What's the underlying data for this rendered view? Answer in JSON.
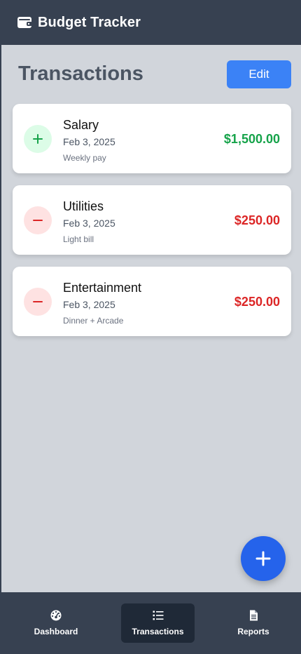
{
  "app": {
    "title": "Budget Tracker"
  },
  "page": {
    "title": "Transactions",
    "edit_label": "Edit"
  },
  "transactions": [
    {
      "name": "Salary",
      "date": "Feb 3, 2025",
      "note": "Weekly pay",
      "amount": "$1,500.00",
      "type": "income"
    },
    {
      "name": "Utilities",
      "date": "Feb 3, 2025",
      "note": "Light bill",
      "amount": "$250.00",
      "type": "expense"
    },
    {
      "name": "Entertainment",
      "date": "Feb 3, 2025",
      "note": "Dinner + Arcade",
      "amount": "$250.00",
      "type": "expense"
    }
  ],
  "nav": {
    "items": [
      {
        "label": "Dashboard",
        "icon": "dashboard-icon",
        "active": false
      },
      {
        "label": "Transactions",
        "icon": "list-icon",
        "active": true
      },
      {
        "label": "Reports",
        "icon": "document-icon",
        "active": false
      }
    ]
  },
  "colors": {
    "income": "#16a34a",
    "expense": "#dc2626",
    "accent": "#3b82f6",
    "fab": "#2563eb"
  }
}
